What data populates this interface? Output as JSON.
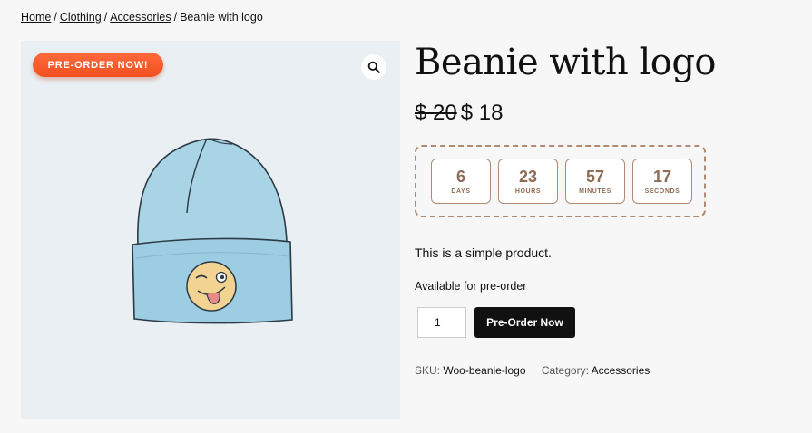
{
  "breadcrumb": {
    "home": "Home",
    "sep": "/",
    "clothing": "Clothing",
    "accessories": "Accessories",
    "current": "Beanie with logo"
  },
  "gallery": {
    "badge": "PRE-ORDER NOW!",
    "zoom_icon": "magnifier-icon",
    "image_icon": "beanie-image"
  },
  "product": {
    "title": "Beanie with logo",
    "regular_price": "$ 20",
    "sale_price": "$ 18",
    "description": "This is a simple product.",
    "availability": "Available for pre-order",
    "quantity": "1",
    "button_label": "Pre-Order Now",
    "sku_label": "SKU:",
    "sku_value": "Woo-beanie-logo",
    "category_label": "Category:",
    "category_value": "Accessories"
  },
  "countdown": [
    {
      "value": "6",
      "label": "DAYS"
    },
    {
      "value": "23",
      "label": "HOURS"
    },
    {
      "value": "57",
      "label": "MINUTES"
    },
    {
      "value": "17",
      "label": "SECONDS"
    }
  ],
  "colors": {
    "badge": "#f2501f",
    "countdown_border": "#b08b72",
    "button": "#111111",
    "beanie": "#a9d4e6"
  }
}
